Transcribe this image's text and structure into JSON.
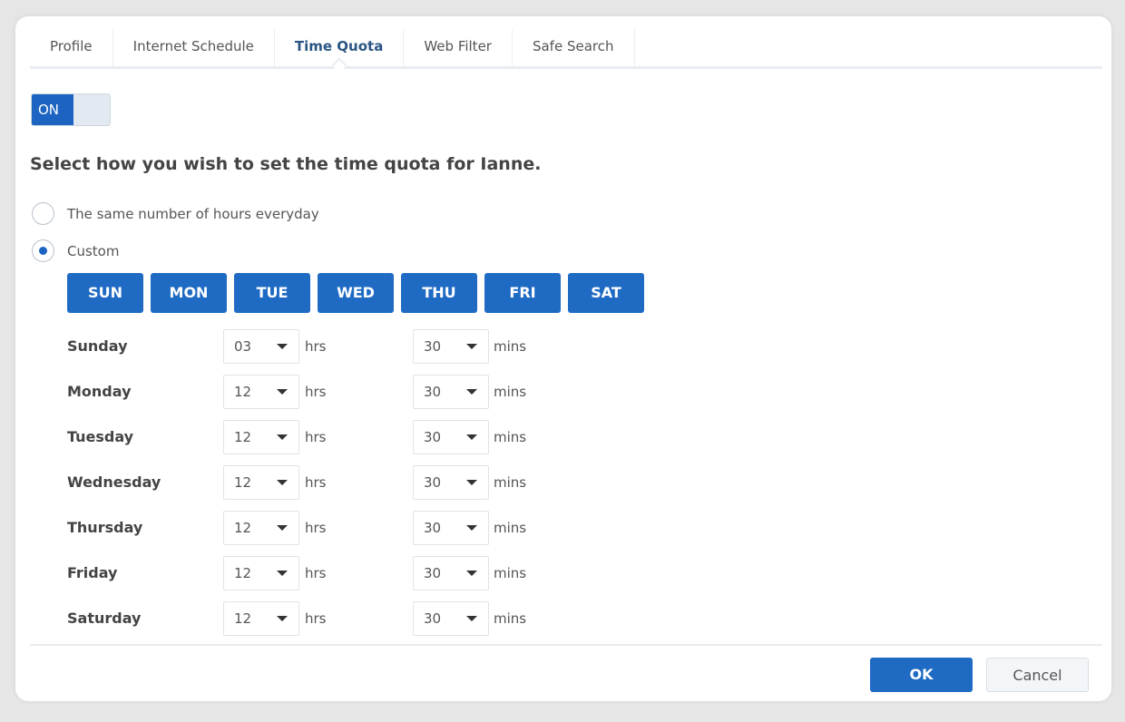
{
  "tabs": [
    {
      "label": "Profile"
    },
    {
      "label": "Internet Schedule"
    },
    {
      "label": "Time Quota",
      "active": true
    },
    {
      "label": "Web Filter"
    },
    {
      "label": "Safe Search"
    }
  ],
  "toggle": {
    "label": "ON",
    "state": true
  },
  "heading": "Select how you wish to set the time quota for Ianne.",
  "options": [
    {
      "label": "The same number of hours everyday",
      "selected": false
    },
    {
      "label": "Custom",
      "selected": true
    }
  ],
  "day_buttons": [
    "SUN",
    "MON",
    "TUE",
    "WED",
    "THU",
    "FRI",
    "SAT"
  ],
  "hrs_unit": "hrs",
  "mins_unit": "mins",
  "rows": [
    {
      "day": "Sunday",
      "hrs": "03",
      "mins": "30"
    },
    {
      "day": "Monday",
      "hrs": "12",
      "mins": "30"
    },
    {
      "day": "Tuesday",
      "hrs": "12",
      "mins": "30"
    },
    {
      "day": "Wednesday",
      "hrs": "12",
      "mins": "30"
    },
    {
      "day": "Thursday",
      "hrs": "12",
      "mins": "30"
    },
    {
      "day": "Friday",
      "hrs": "12",
      "mins": "30"
    },
    {
      "day": "Saturday",
      "hrs": "12",
      "mins": "30"
    }
  ],
  "footer": {
    "ok": "OK",
    "cancel": "Cancel"
  },
  "colors": {
    "accent": "#1f6bc4",
    "active_tab": "#2b5583"
  }
}
